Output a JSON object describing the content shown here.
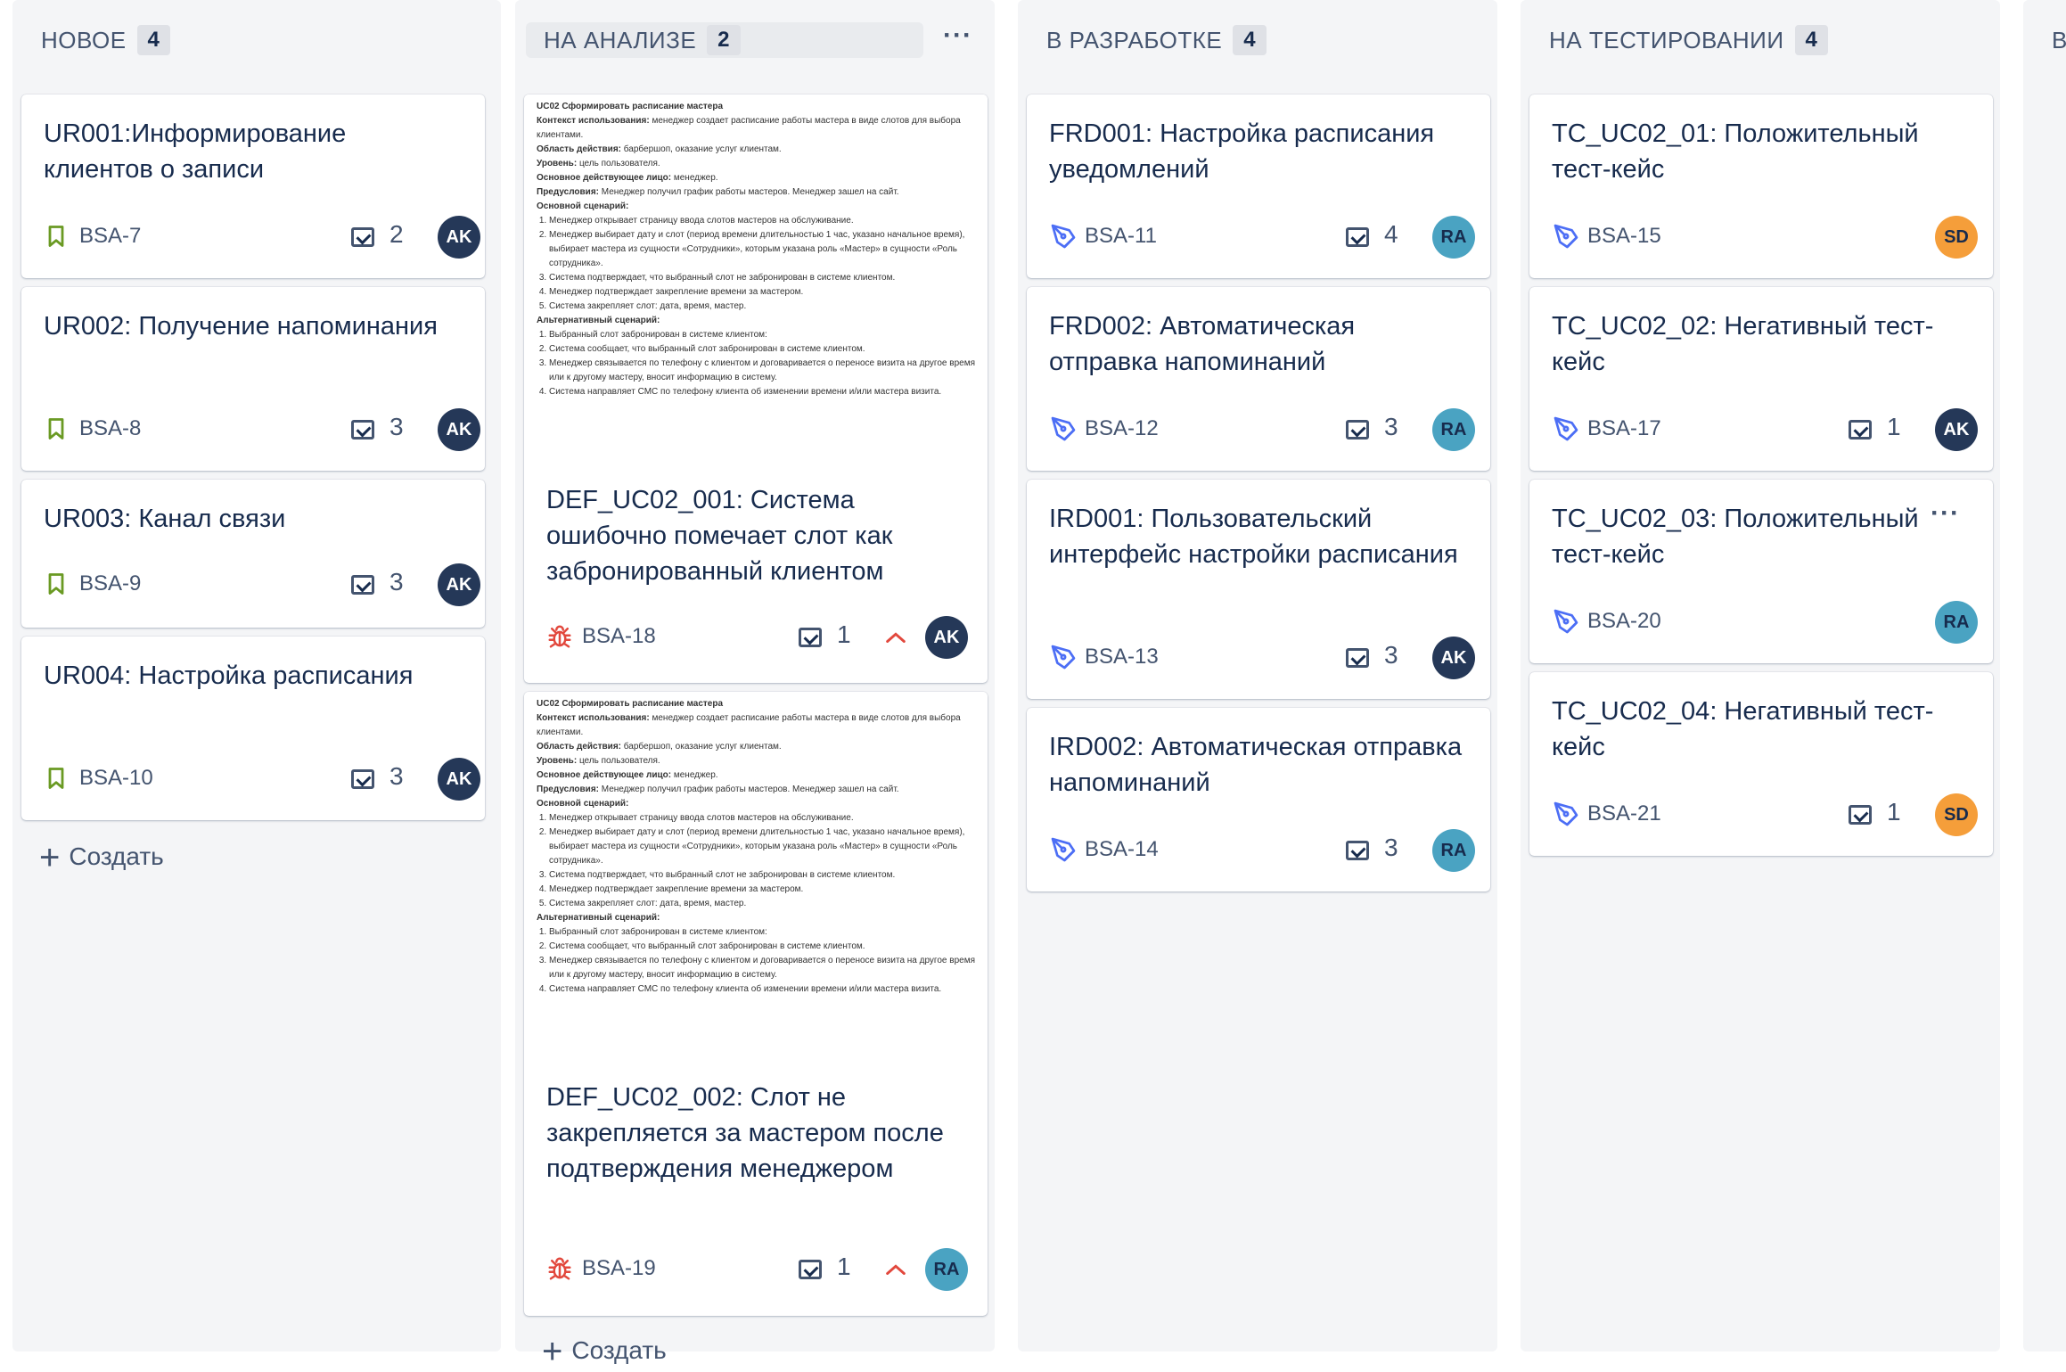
{
  "columns": [
    {
      "title": "НОВОЕ",
      "count": "4",
      "cards": [
        {
          "title": "UR001:Информирование клиентов о записи",
          "key": "BSA-7",
          "subtasks": "2",
          "assignee": "AK",
          "type": "story"
        },
        {
          "title": "UR002: Получение напоминания",
          "key": "BSA-8",
          "subtasks": "3",
          "assignee": "AK",
          "type": "story"
        },
        {
          "title": "UR003: Канал связи",
          "key": "BSA-9",
          "subtasks": "3",
          "assignee": "AK",
          "type": "story"
        },
        {
          "title": "UR004: Настройка расписания",
          "key": "BSA-10",
          "subtasks": "3",
          "assignee": "AK",
          "type": "story"
        }
      ],
      "create_label": "Создать"
    },
    {
      "title": "НА АНАЛИЗЕ",
      "count": "2",
      "cards": [
        {
          "title": "DEF_UC02_001: Система ошибочно помечает слот как забронированный клиентом",
          "key": "BSA-18",
          "subtasks": "1",
          "assignee": "AK",
          "type": "bug"
        },
        {
          "title": "DEF_UC02_002: Слот не закрепляется за мастером после подтверждения менеджером",
          "key": "BSA-19",
          "subtasks": "1",
          "assignee": "RA",
          "type": "bug"
        }
      ],
      "preview": {
        "heading": "UC02 Сформировать расписание мастера",
        "context_label": "Контекст использования:",
        "context": "менеджер создает расписание работы мастера в виде слотов для выбора клиентами.",
        "scope_label": "Область действия:",
        "scope": "барбершоп, оказание услуг клиентам.",
        "level_label": "Уровень:",
        "level": "цель пользователя.",
        "actor_label": "Основное действующее лицо:",
        "actor": "менеджер.",
        "pre_label": "Предусловия:",
        "pre": "Менеджер получил график работы мастеров. Менеджер зашел на сайт.",
        "main_label": "Основной сценарий:",
        "main_steps_1": [
          "Менеджер открывает страницу ввода слотов мастеров на обслуживание.",
          "Менеджер выбирает дату и слот (период времени длительностью 1 час, указано начальное время), выбирает мастера из сущности «Сотрудники», которым указана роль «Мастер» в сущности «Роль сотрудника».",
          "Система подтверждает, что выбранный слот не забронирован в системе клиентом.",
          "Менеджер подтверждает закрепление времени за мастером.",
          "Система закрепляет слот: дата, время, мастер."
        ],
        "alt_label": "Альтернативный сценарий:",
        "alt_steps": [
          "Выбранный слот забронирован в системе клиентом:",
          "Система сообщает, что выбранный слот забронирован в системе клиентом.",
          "Менеджер связывается по телефону с клиентом и договаривается о переносе визита на другое время или к другому мастеру, вносит информацию в систему.",
          "Система направляет СМС по телефону клиента об изменении времени и/или мастера визита."
        ]
      },
      "create_label": "Создать"
    },
    {
      "title": "В РАЗРАБОТКЕ",
      "count": "4",
      "cards": [
        {
          "title": "FRD001: Настройка расписания уведомлений",
          "key": "BSA-11",
          "subtasks": "4",
          "assignee": "RA",
          "type": "task"
        },
        {
          "title": "FRD002: Автоматическая отправка напоминаний",
          "key": "BSA-12",
          "subtasks": "3",
          "assignee": "RA",
          "type": "task"
        },
        {
          "title": "IRD001: Пользовательский интерфейс настройки расписания",
          "key": "BSA-13",
          "subtasks": "3",
          "assignee": "AK",
          "type": "task"
        },
        {
          "title": "IRD002: Автоматическая отправка напоминаний",
          "key": "BSA-14",
          "subtasks": "3",
          "assignee": "RA",
          "type": "task"
        }
      ]
    },
    {
      "title": "НА ТЕСТИРОВАНИИ",
      "count": "4",
      "cards": [
        {
          "title": "TC_UC02_01: Положительный тест-кейс",
          "key": "BSA-15",
          "subtasks": "",
          "assignee": "SD",
          "type": "task"
        },
        {
          "title": "TC_UC02_02: Негативный тест-кейс",
          "key": "BSA-17",
          "subtasks": "1",
          "assignee": "AK",
          "type": "task"
        },
        {
          "title": "TC_UC02_03: Положительный тест-кейс",
          "key": "BSA-20",
          "subtasks": "",
          "assignee": "RA",
          "type": "task"
        },
        {
          "title": "TC_UC02_04: Негативный тест-кейс",
          "key": "BSA-21",
          "subtasks": "1",
          "assignee": "SD",
          "type": "task"
        }
      ]
    },
    {
      "title": "В"
    }
  ],
  "icons": {
    "story": "bookmark-icon",
    "bug": "bug-icon",
    "task": "pen-icon",
    "subtasks": "checkbox-icon",
    "priority": "chevron-up-icon",
    "more": "more-dots-icon",
    "create": "plus-icon"
  },
  "colors": {
    "story": "#6a9a23",
    "bug": "#e2483d",
    "task": "#4c6ef5",
    "avatar_ak": "#253858",
    "avatar_ra": "#4aa3c2",
    "avatar_sd": "#f59e3a",
    "column_bg": "#f4f5f7"
  }
}
